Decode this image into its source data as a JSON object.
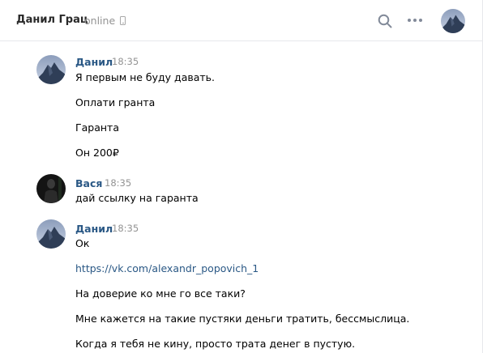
{
  "header": {
    "title": "Данил Грац",
    "status": "online"
  },
  "colors": {
    "author_link": "#2a5885",
    "timestamp": "#939393",
    "divider": "#e7e8ec",
    "icon": "#828a99"
  },
  "icons": [
    "phone-icon",
    "search-icon",
    "more-icon"
  ],
  "messages": [
    {
      "author": "Данил",
      "time": "18:35",
      "lines": [
        "Я первым не буду давать.",
        "Оплати гранта",
        "Гаранта",
        "Он 200₽"
      ]
    },
    {
      "author": "Вася",
      "time": "18:35",
      "lines": [
        "дай ссылку на гаранта"
      ]
    },
    {
      "author": "Данил",
      "time": "18:35",
      "lines": [
        "Ок",
        "https://vk.com/alexandr_popovich_1",
        "На доверие ко мне го все таки?",
        "Мне кажется на такие пустяки деньги тратить, бессмыслица.",
        "Когда я тебя не кину, просто трата денег в пустую."
      ]
    }
  ]
}
